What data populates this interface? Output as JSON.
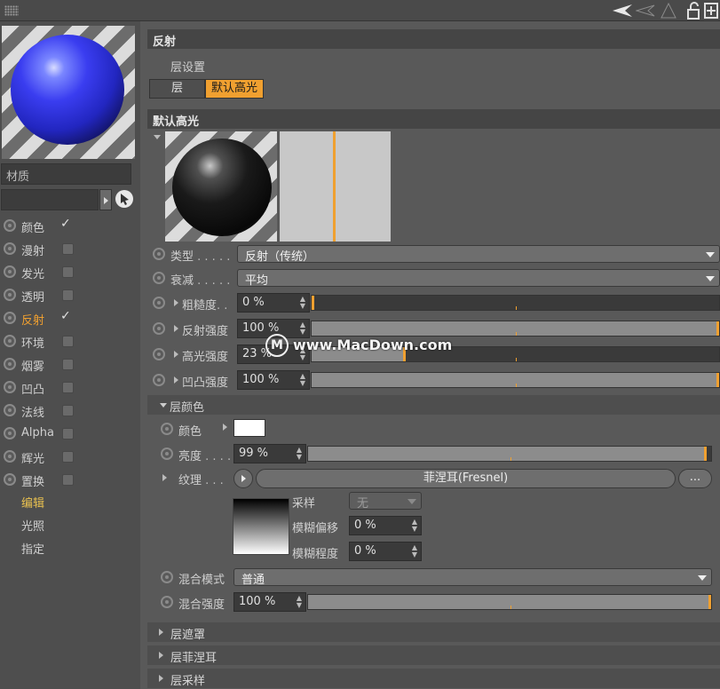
{
  "topbar": {
    "icons": [
      "grip-icon",
      "arrow-left-icon",
      "arrow-left-outline-icon",
      "triangle-up-icon",
      "lock-icon",
      "add-panel-icon"
    ]
  },
  "left": {
    "material_label": "材质",
    "channels": [
      {
        "label": "颜色",
        "checked": true,
        "active": false
      },
      {
        "label": "漫射",
        "checked": false,
        "active": false
      },
      {
        "label": "发光",
        "checked": false,
        "active": false
      },
      {
        "label": "透明",
        "checked": false,
        "active": false
      },
      {
        "label": "反射",
        "checked": true,
        "active": true
      },
      {
        "label": "环境",
        "checked": false,
        "active": false
      },
      {
        "label": "烟雾",
        "checked": false,
        "active": false
      },
      {
        "label": "凹凸",
        "checked": false,
        "active": false
      },
      {
        "label": "法线",
        "checked": false,
        "active": false
      },
      {
        "label": "Alpha",
        "checked": false,
        "active": false
      },
      {
        "label": "辉光",
        "checked": false,
        "active": false
      },
      {
        "label": "置换",
        "checked": false,
        "active": false
      }
    ],
    "extra": [
      "编辑",
      "光照",
      "指定"
    ]
  },
  "right": {
    "reflection_header": "反射",
    "layer_settings": "层设置",
    "tab_layer": "层",
    "tab_default": "默认高光",
    "default_header": "默认高光",
    "type": {
      "label": "类型",
      "dots": ". . . . .",
      "value": "反射（传统）"
    },
    "falloff": {
      "label": "衰减",
      "dots": ". . . . .",
      "value": "平均"
    },
    "roughness": {
      "label": "粗糙度",
      "dots": ". .",
      "value": "0 %",
      "level": 0
    },
    "refl_strength": {
      "label": "反射强度",
      "value": "100 %",
      "level": 1
    },
    "spec_strength": {
      "label": "高光强度",
      "value": "23 %",
      "level": 0.23
    },
    "bump_strength": {
      "label": "凹凸强度",
      "value": "100 %",
      "level": 1
    },
    "layer_color_header": "层颜色",
    "color": {
      "label": "颜色"
    },
    "brightness": {
      "label": "亮度",
      "dots": ". . . .",
      "value": "99 %",
      "level": 0.99
    },
    "texture": {
      "label": "纹理",
      "dots": ". . .",
      "button": "菲涅耳(Fresnel)",
      "more": "..."
    },
    "sampling": {
      "label": "采样",
      "value": "无"
    },
    "blur_offset": {
      "label": "模糊偏移",
      "value": "0 %"
    },
    "blur_degree": {
      "label": "模糊程度",
      "value": "0 %"
    },
    "blend_mode": {
      "label": "混合模式",
      "value": "普通"
    },
    "blend_strength": {
      "label": "混合强度",
      "value": "100 %",
      "level": 1
    },
    "sections": [
      "层遮罩",
      "层菲涅耳",
      "层采样"
    ]
  },
  "watermark": "www.MacDown.com"
}
